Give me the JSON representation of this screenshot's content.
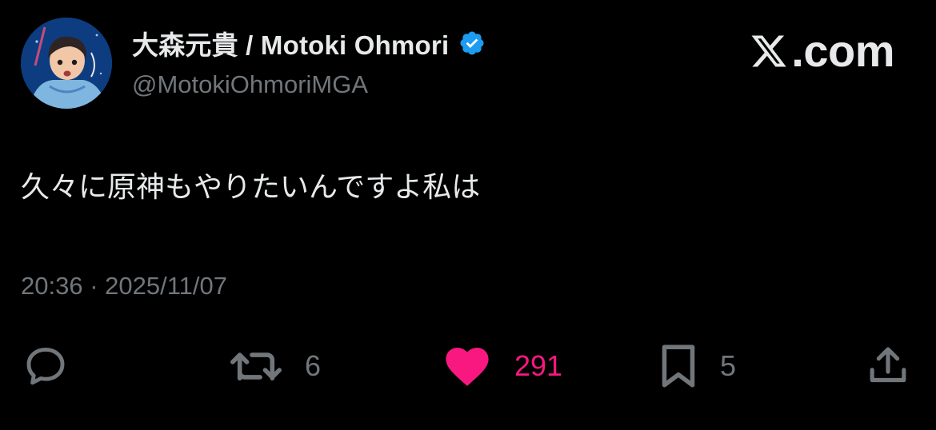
{
  "author": {
    "display_name": "大森元貴 / Motoki Ohmori",
    "handle": "@MotokiOhmoriMGA",
    "verified": true,
    "verified_color": "#1d9bf0"
  },
  "brand": {
    "label": ".com",
    "icon": "x-logo-icon"
  },
  "tweet": {
    "text": "久々に原神もやりたいんですよ私は",
    "meta": "20:36 · 2025/11/07"
  },
  "actions": {
    "reply": {
      "icon": "reply-icon"
    },
    "retweet": {
      "icon": "retweet-icon",
      "count": "6"
    },
    "like": {
      "icon": "heart-icon",
      "count": "291",
      "active": true,
      "color": "#f91880"
    },
    "bookmark": {
      "icon": "bookmark-icon",
      "count": "5"
    },
    "share": {
      "icon": "share-icon"
    }
  },
  "colors": {
    "background": "#000000",
    "text_primary": "#e7e9ea",
    "text_secondary": "#71767b"
  }
}
